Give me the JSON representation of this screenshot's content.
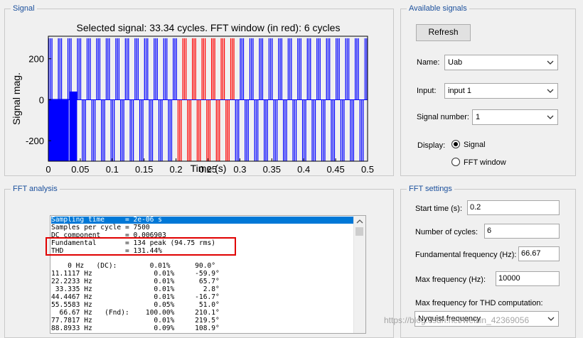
{
  "signal_panel": {
    "title": "Signal",
    "plot_title": "Selected signal: 33.34 cycles. FFT window (in red): 6 cycles",
    "ylabel": "Signal mag.",
    "xlabel": "Time (s)"
  },
  "chart_data": {
    "type": "line",
    "title": "Selected signal: 33.34 cycles. FFT window (in red): 6 cycles",
    "xlabel": "Time (s)",
    "ylabel": "Signal mag.",
    "xlim": [
      0,
      0.5
    ],
    "ylim": [
      -300,
      310
    ],
    "x_ticks": [
      "0",
      "0.05",
      "0.1",
      "0.15",
      "0.2",
      "0.25",
      "0.3",
      "0.35",
      "0.4",
      "0.45",
      "0.5"
    ],
    "y_ticks": [
      "200",
      "0",
      "-200"
    ],
    "fundamental_hz": 66.67,
    "peak_magnitude": 300,
    "duty": 0.5,
    "fft_window": [
      0.2,
      0.29
    ],
    "series": [
      {
        "color": "#0000ff"
      },
      {
        "color": "#ff0000"
      }
    ],
    "grid": false
  },
  "available_signals": {
    "title": "Available signals",
    "refresh_label": "Refresh",
    "name_label": "Name:",
    "name_value": "Uab",
    "input_label": "Input:",
    "input_value": "input 1",
    "signal_number_label": "Signal number:",
    "signal_number_value": "1",
    "display_label": "Display:",
    "display_signal": "Signal",
    "display_fft": "FFT window"
  },
  "fft_analysis": {
    "title": "FFT analysis",
    "rows": [
      "Sampling time     = 2e-06 s",
      "Samples per cycle = 7500",
      "DC component      = 0.006903",
      "Fundamental       = 134 peak (94.75 rms)",
      "THD               = 131.44%",
      "",
      "    0 Hz   (DC):        0.01%      90.0°",
      "11.1117 Hz               0.01%     -59.9°",
      "22.2233 Hz               0.01%      65.7°",
      " 33.335 Hz               0.01%       2.8°",
      "44.4467 Hz               0.01%     -16.7°",
      "55.5583 Hz               0.05%      51.0°",
      "  66.67 Hz   (Fnd):    100.00%     210.1°",
      "77.7817 Hz               0.01%     219.5°",
      "88.8933 Hz               0.09%     108.9°"
    ]
  },
  "fft_settings": {
    "title": "FFT settings",
    "start_time_label": "Start time (s):",
    "start_time_value": "0.2",
    "num_cycles_label": "Number of cycles:",
    "num_cycles_value": "6",
    "fund_freq_label": "Fundamental frequency (Hz):",
    "fund_freq_value": "66.67",
    "max_freq_label": "Max frequency (Hz):",
    "max_freq_value": "10000",
    "max_thd_label": "Max frequency for THD computation:",
    "max_thd_value": "Nyquist frequency"
  },
  "watermark": "https://blog.csdn.net/weixin_42369056"
}
